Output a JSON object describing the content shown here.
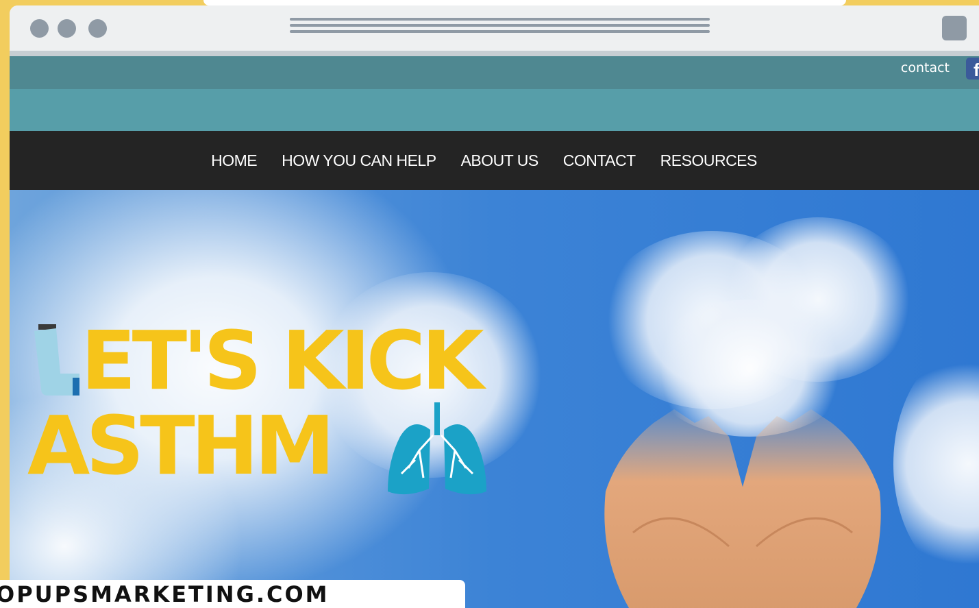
{
  "header": {
    "contact_link": "contact",
    "facebook_icon_glyph": "f"
  },
  "nav": {
    "items": [
      "HOME",
      "HOW YOU CAN HELP",
      "ABOUT US",
      "CONTACT",
      "RESOURCES"
    ]
  },
  "hero": {
    "headline_line1": "ET'S KICK",
    "headline_line2": "ASTHM",
    "inhaler_icon": "inhaler-icon",
    "lungs_icon": "lungs-icon"
  },
  "footer_brand": "OPUPSMARKETING.COM",
  "colors": {
    "frame": "#f2cd5e",
    "utility_bar": "#4f8891",
    "teal_band": "#579ea9",
    "nav_bar": "#242424",
    "headline": "#f6c41a",
    "icon_teal": "#1ba2c7",
    "facebook": "#3b5a9a"
  }
}
